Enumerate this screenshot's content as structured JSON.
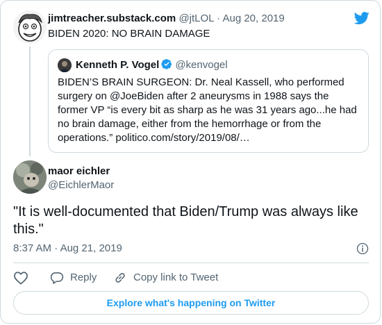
{
  "parent_tweet": {
    "display_name": "jimtreacher.substack.com",
    "handle": "@jtLOL",
    "separator": "·",
    "date": "Aug 20, 2019",
    "text": "BIDEN 2020: NO BRAIN DAMAGE"
  },
  "quoted_tweet": {
    "display_name": "Kenneth P. Vogel",
    "handle": "@kenvogel",
    "text": "BIDEN’S BRAIN SURGEON: Dr. Neal Kassell, who performed surgery on @JoeBiden after 2 aneurysms in 1988 says the former VP “is every bit as sharp as he was 31 years ago...he had no brain damage, either from the hemorrhage or from the operations.” politico.com/story/2019/08/…"
  },
  "main_tweet": {
    "display_name": "maor eichler",
    "handle": "@EichlerMaor",
    "text": "\"It is well-documented that Biden/Trump was always like this.\"",
    "time": "8:37 AM",
    "separator": "·",
    "date": "Aug 21, 2019"
  },
  "actions": {
    "reply_label": "Reply",
    "copy_link_label": "Copy link to Tweet"
  },
  "explore_label": "Explore what's happening on Twitter",
  "colors": {
    "twitter_blue": "#1d9bf0",
    "verified_blue": "#1d9bf0",
    "like_red": "#f91880",
    "muted_text": "#536471",
    "border": "#cfd9de"
  },
  "icons": {
    "logo": "twitter-bird-icon",
    "verified": "verified-badge-icon",
    "info": "info-icon",
    "like": "heart-icon",
    "reply": "reply-bubble-icon",
    "copy_link": "link-icon"
  }
}
